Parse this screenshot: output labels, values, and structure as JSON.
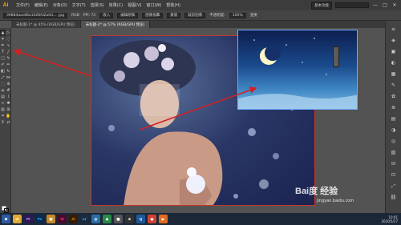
{
  "app": {
    "logo": "Ai"
  },
  "menubar": {
    "items": [
      "文件(F)",
      "编辑(E)",
      "对象(O)",
      "文字(T)",
      "选择(S)",
      "效果(C)",
      "视图(V)",
      "窗口(W)",
      "帮助(H)"
    ],
    "workspace": "基本功能",
    "window_controls": [
      "—",
      "□",
      "✕"
    ]
  },
  "controlbar": {
    "fields": [
      "39884aac88a1026fd2a0d... .jpg",
      "RGB",
      "PPI: 72",
      "嵌入",
      "编辑原稿",
      "图像描摹",
      "蒙版",
      "裁剪图像",
      "不透明度:",
      "100%",
      "变换"
    ]
  },
  "tabs": [
    {
      "label": "未标题-1* @ 45% (RGB/GPU 预览)",
      "active": false
    },
    {
      "label": "未标题-2* @ 57% (RGB/GPU 预览)",
      "active": true
    }
  ],
  "status": {
    "zoom": "57%"
  },
  "taskbar": {
    "apps": [
      {
        "name": "start",
        "label": "⊞",
        "color": "#2d5aa0"
      },
      {
        "name": "explorer",
        "label": "📁",
        "color": "#e0a83a"
      },
      {
        "name": "premiere",
        "label": "Pr",
        "color": "#2a1a55"
      },
      {
        "name": "photoshop",
        "label": "Ps",
        "color": "#0a2a52"
      },
      {
        "name": "folder",
        "label": "▤",
        "color": "#c58a2a"
      },
      {
        "name": "indesign",
        "label": "Id",
        "color": "#4a0b2a"
      },
      {
        "name": "illustrator",
        "label": "Ai",
        "color": "#3a1a00"
      },
      {
        "name": "lightroom",
        "label": "Lr",
        "color": "#1a2a40"
      },
      {
        "name": "app-blue",
        "label": "◎",
        "color": "#2a6ea8"
      },
      {
        "name": "app-green",
        "label": "◆",
        "color": "#2a8a4a"
      },
      {
        "name": "app-gray",
        "label": "▦",
        "color": "#555"
      },
      {
        "name": "app-dark",
        "label": "■",
        "color": "#333"
      },
      {
        "name": "qq",
        "label": "Q",
        "color": "#1a5a9a"
      },
      {
        "name": "chrome",
        "label": "◉",
        "color": "#d04030"
      },
      {
        "name": "media",
        "label": "▶",
        "color": "#e06a20"
      }
    ],
    "time": "10:01",
    "date": "2020/5/27"
  },
  "watermark": {
    "brand": "Bai度 经验",
    "url": "jingyan.baidu.com"
  },
  "colors": {
    "arrow": "#d42020",
    "artboard_border": "#c0392b",
    "selection": "#6fa8ff"
  }
}
